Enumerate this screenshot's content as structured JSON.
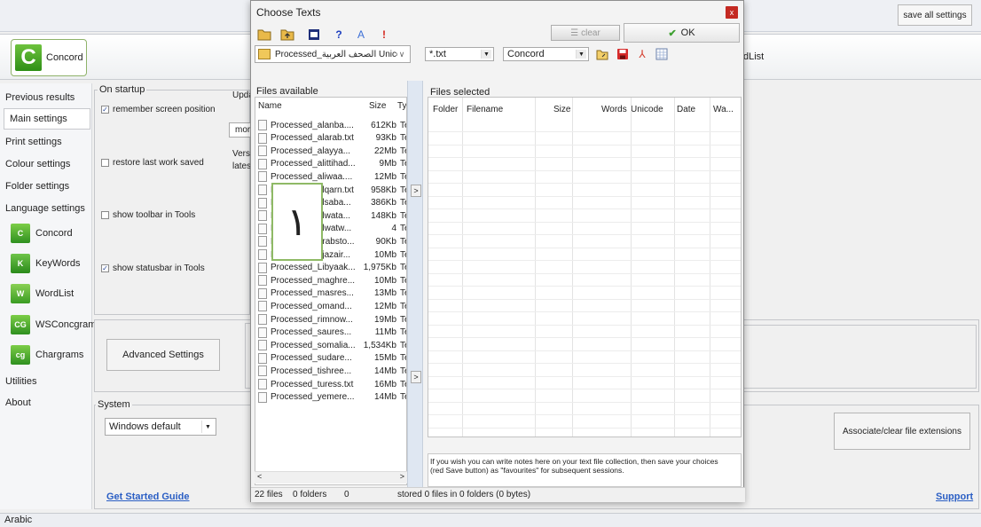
{
  "app": {
    "save_all_label": "save all settings",
    "concord_logo_letter": "C",
    "concord_logo_label": "Concord",
    "wordlist_fragment": "dList",
    "status_bar_text": "Arabic"
  },
  "sidebar": {
    "items": [
      {
        "label": "Previous results"
      },
      {
        "label": "Main settings"
      },
      {
        "label": "Print settings"
      },
      {
        "label": "Colour settings"
      },
      {
        "label": "Folder settings"
      },
      {
        "label": "Language settings"
      }
    ],
    "tools": [
      {
        "icon_text": "C",
        "label": "Concord"
      },
      {
        "icon_text": "K",
        "label": "KeyWords"
      },
      {
        "icon_text": "W",
        "label": "WordList"
      },
      {
        "icon_text": "CG",
        "label": "WSConcgram"
      },
      {
        "icon_text": "cg",
        "label": "Chargrams"
      }
    ],
    "bottom": [
      {
        "label": "Utilities"
      },
      {
        "label": "About"
      }
    ]
  },
  "main": {
    "startup_title": "On startup",
    "checkboxes": [
      {
        "label": "remember screen position",
        "checked": true
      },
      {
        "label": "restore last work saved",
        "checked": false
      },
      {
        "label": "show toolbar in Tools",
        "checked": false
      },
      {
        "label": "show statusbar in Tools",
        "checked": true
      }
    ],
    "update_frag": "Upda",
    "mor_frag": "mor",
    "version_frag": "Vers",
    "latest_frag": "lates",
    "advanced_label": "Advanced Settings",
    "system_title": "System",
    "system_value": "Windows default",
    "get_started": "Get Started Guide",
    "associate_label": "Associate/clear file extensions",
    "support": "Support"
  },
  "dialog": {
    "title": "Choose Texts",
    "close_glyph": "x",
    "toolbar_icons": [
      "folder-icon",
      "folder-up-icon",
      "stop-icon",
      "help-icon",
      "font-icon",
      "warning-icon"
    ],
    "clear_label": "clear",
    "ok_label": "OK",
    "folder_value": "Processed_الصحف العربية Unicode",
    "filter_value": "*.txt",
    "language_value": "Concord",
    "files_available_label": "Files available",
    "files_available_headers": {
      "name": "Name",
      "size": "Size",
      "type": "Ty"
    },
    "files": [
      {
        "name": "Processed_alanba....",
        "size": "612Kb",
        "type": "Te"
      },
      {
        "name": "Processed_alarab.txt",
        "size": "93Kb",
        "type": "Te"
      },
      {
        "name": "Processed_alayya...",
        "size": "22Mb",
        "type": "Te"
      },
      {
        "name": "Processed_alittihad...",
        "size": "9Mb",
        "type": "Te"
      },
      {
        "name": "Processed_aliwaa....",
        "size": "12Mb",
        "type": "Te"
      },
      {
        "name": "Processed_alqarn.txt",
        "size": "958Kb",
        "type": "Te"
      },
      {
        "name": "Processed_alsaba...",
        "size": "386Kb",
        "type": "Te"
      },
      {
        "name": "Processed_alwata...",
        "size": "148Kb",
        "type": "Te"
      },
      {
        "name": "Processed_alwatw...",
        "size": "4",
        "type": "Te"
      },
      {
        "name": "Processed_arabsto...",
        "size": "90Kb",
        "type": "Te"
      },
      {
        "name": "Processed_djazair...",
        "size": "10Mb",
        "type": "Te"
      },
      {
        "name": "Processed_Libyaak...",
        "size": "1,975Kb",
        "type": "Te"
      },
      {
        "name": "Processed_maghre...",
        "size": "10Mb",
        "type": "Te"
      },
      {
        "name": "Processed_masres...",
        "size": "13Mb",
        "type": "Te"
      },
      {
        "name": "Processed_omand...",
        "size": "12Mb",
        "type": "Te"
      },
      {
        "name": "Processed_rimnow...",
        "size": "19Mb",
        "type": "Te"
      },
      {
        "name": "Processed_saures...",
        "size": "11Mb",
        "type": "Te"
      },
      {
        "name": "Processed_somalia...",
        "size": "1,534Kb",
        "type": "Te"
      },
      {
        "name": "Processed_sudare...",
        "size": "15Mb",
        "type": "Te"
      },
      {
        "name": "Processed_tishree...",
        "size": "14Mb",
        "type": "Te"
      },
      {
        "name": "Processed_turess.txt",
        "size": "16Mb",
        "type": "Te"
      },
      {
        "name": "Processed_yemere...",
        "size": "14Mb",
        "type": "Te"
      }
    ],
    "files_selected_label": "Files selected",
    "files_selected_headers": [
      "Folder",
      "Filename",
      "Size",
      "Words",
      "Unicode",
      "Date",
      "Wa..."
    ],
    "big_number": "١",
    "notes_text": "If you wish you can write notes here on your text file collection, then save your choices (red Save button) as \"favourites\" for subsequent sessions.",
    "status": {
      "files_count": "22 files",
      "folders_count": "0 folders",
      "zero": "0",
      "stored": "stored 0 files in 0 folders (0 bytes)"
    }
  }
}
